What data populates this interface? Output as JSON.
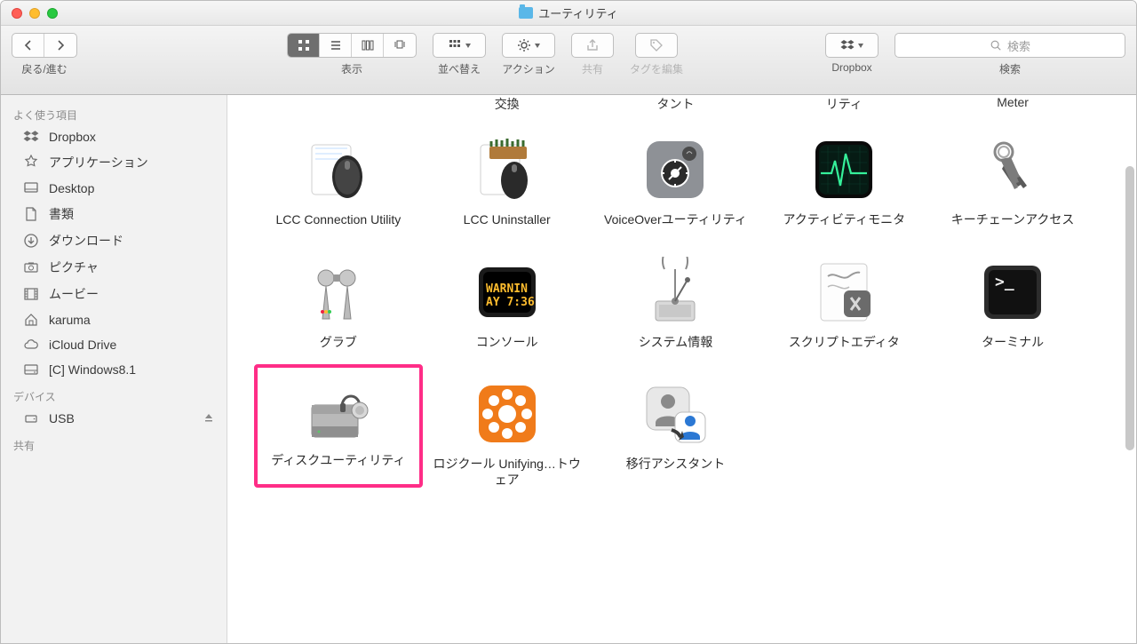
{
  "window": {
    "title": "ユーティリティ"
  },
  "toolbar": {
    "back_forward_label": "戻る/進む",
    "view_label": "表示",
    "arrange_label": "並べ替え",
    "action_label": "アクション",
    "share_label": "共有",
    "tags_label": "タグを編集",
    "dropbox_label": "Dropbox",
    "search_label": "検索",
    "search_placeholder": "検索"
  },
  "sidebar": {
    "sections": [
      {
        "header": "よく使う項目",
        "items": [
          {
            "label": "Dropbox",
            "icon": "dropbox-icon"
          },
          {
            "label": "アプリケーション",
            "icon": "applications-icon"
          },
          {
            "label": "Desktop",
            "icon": "desktop-icon"
          },
          {
            "label": "書類",
            "icon": "documents-icon"
          },
          {
            "label": "ダウンロード",
            "icon": "downloads-icon"
          },
          {
            "label": "ピクチャ",
            "icon": "pictures-icon"
          },
          {
            "label": "ムービー",
            "icon": "movies-icon"
          },
          {
            "label": "karuma",
            "icon": "home-icon"
          },
          {
            "label": "iCloud Drive",
            "icon": "icloud-icon"
          },
          {
            "label": "[C] Windows8.1",
            "icon": "drive-icon"
          }
        ]
      },
      {
        "header": "デバイス",
        "items": [
          {
            "label": "USB",
            "icon": "disk-icon",
            "ejectable": true
          }
        ]
      },
      {
        "header": "共有",
        "items": []
      }
    ]
  },
  "partial_row": [
    "交換",
    "タント",
    "リティ",
    "Meter"
  ],
  "grid": [
    [
      {
        "label": "LCC Connection Utility",
        "icon": "mouse-icon"
      },
      {
        "label": "LCC Uninstaller",
        "icon": "broom-icon"
      },
      {
        "label": "VoiceOverユーティリティ",
        "icon": "voiceover-icon"
      },
      {
        "label": "アクティビティモニタ",
        "icon": "activity-monitor-icon"
      },
      {
        "label": "キーチェーンアクセス",
        "icon": "keychain-icon"
      }
    ],
    [
      {
        "label": "グラブ",
        "icon": "grab-icon"
      },
      {
        "label": "コンソール",
        "icon": "console-icon",
        "console_text1": "WARNIN",
        "console_text2": "AY 7:36"
      },
      {
        "label": "システム情報",
        "icon": "system-info-icon"
      },
      {
        "label": "スクリプトエディタ",
        "icon": "script-editor-icon"
      },
      {
        "label": "ターミナル",
        "icon": "terminal-icon",
        "terminal_prompt": ">_"
      }
    ],
    [
      {
        "label": "ディスクユーティリティ",
        "icon": "disk-utility-icon",
        "highlighted": true
      },
      {
        "label": "ロジクール Unifying…トウェア",
        "icon": "logitech-icon"
      },
      {
        "label": "移行アシスタント",
        "icon": "migration-icon"
      }
    ]
  ]
}
